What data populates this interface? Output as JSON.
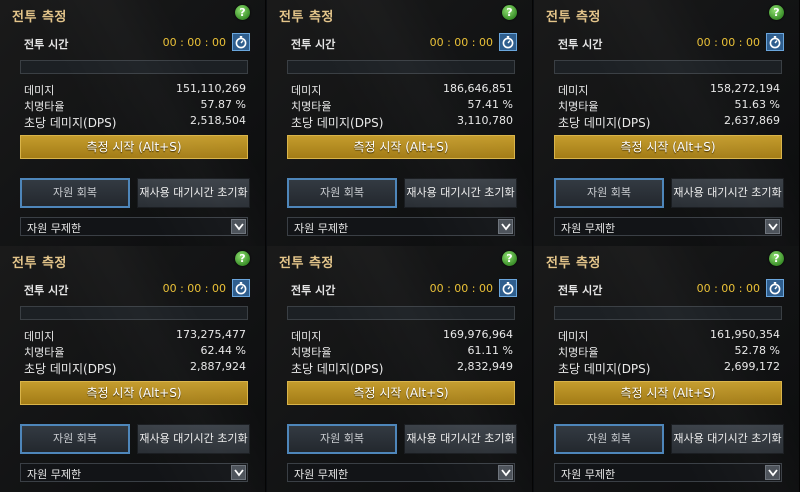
{
  "panels": [
    {
      "title": "전투 측정",
      "help_label": "?",
      "time_label": "전투 시간",
      "time_value": "00 : 00 : 00",
      "progress": 0,
      "stats": [
        {
          "label": "데미지",
          "value": "151,110,269"
        },
        {
          "label": "치명타율",
          "value": "57.87 %"
        },
        {
          "label": "초당 데미지(DPS)",
          "value": "2,518,504"
        }
      ],
      "start_label": "측정 시작 (Alt+S)",
      "resource_label": "자원 회복",
      "cooldown_label": "재사용 대기시간 초기화",
      "dropdown_value": "자원 무제한"
    },
    {
      "title": "전투 측정",
      "help_label": "?",
      "time_label": "전투 시간",
      "time_value": "00 : 00 : 00",
      "progress": 0,
      "stats": [
        {
          "label": "데미지",
          "value": "186,646,851"
        },
        {
          "label": "치명타율",
          "value": "57.41 %"
        },
        {
          "label": "초당 데미지(DPS)",
          "value": "3,110,780"
        }
      ],
      "start_label": "측정 시작 (Alt+S)",
      "resource_label": "자원 회복",
      "cooldown_label": "재사용 대기시간 초기화",
      "dropdown_value": "자원 무제한"
    },
    {
      "title": "전투 측정",
      "help_label": "?",
      "time_label": "전투 시간",
      "time_value": "00 : 00 : 00",
      "progress": 0,
      "stats": [
        {
          "label": "데미지",
          "value": "158,272,194"
        },
        {
          "label": "치명타율",
          "value": "51.63 %"
        },
        {
          "label": "초당 데미지(DPS)",
          "value": "2,637,869"
        }
      ],
      "start_label": "측정 시작 (Alt+S)",
      "resource_label": "자원 회복",
      "cooldown_label": "재사용 대기시간 초기화",
      "dropdown_value": "자원 무제한"
    },
    {
      "title": "전투 측정",
      "help_label": "?",
      "time_label": "전투 시간",
      "time_value": "00 : 00 : 00",
      "progress": 0,
      "stats": [
        {
          "label": "데미지",
          "value": "173,275,477"
        },
        {
          "label": "치명타율",
          "value": "62.44 %"
        },
        {
          "label": "초당 데미지(DPS)",
          "value": "2,887,924"
        }
      ],
      "start_label": "측정 시작 (Alt+S)",
      "resource_label": "자원 회복",
      "cooldown_label": "재사용 대기시간 초기화",
      "dropdown_value": "자원 무제한"
    },
    {
      "title": "전투 측정",
      "help_label": "?",
      "time_label": "전투 시간",
      "time_value": "00 : 00 : 00",
      "progress": 0,
      "stats": [
        {
          "label": "데미지",
          "value": "169,976,964"
        },
        {
          "label": "치명타율",
          "value": "61.11 %"
        },
        {
          "label": "초당 데미지(DPS)",
          "value": "2,832,949"
        }
      ],
      "start_label": "측정 시작 (Alt+S)",
      "resource_label": "자원 회복",
      "cooldown_label": "재사용 대기시간 초기화",
      "dropdown_value": "자원 무제한"
    },
    {
      "title": "전투 측정",
      "help_label": "?",
      "time_label": "전투 시간",
      "time_value": "00 : 00 : 00",
      "progress": 0,
      "stats": [
        {
          "label": "데미지",
          "value": "161,950,354"
        },
        {
          "label": "치명타율",
          "value": "52.78 %"
        },
        {
          "label": "초당 데미지(DPS)",
          "value": "2,699,172"
        }
      ],
      "start_label": "측정 시작 (Alt+S)",
      "resource_label": "자원 회복",
      "cooldown_label": "재사용 대기시간 초기화",
      "dropdown_value": "자원 무제한"
    }
  ],
  "colors": {
    "title": "#e4c58a",
    "timer": "#e9c037",
    "start_button": "#b58e22",
    "accent_blue": "#4e86ba"
  },
  "icons": {
    "help": "help-icon",
    "stopwatch": "stopwatch-icon",
    "dropdown": "chevron-down-icon"
  }
}
